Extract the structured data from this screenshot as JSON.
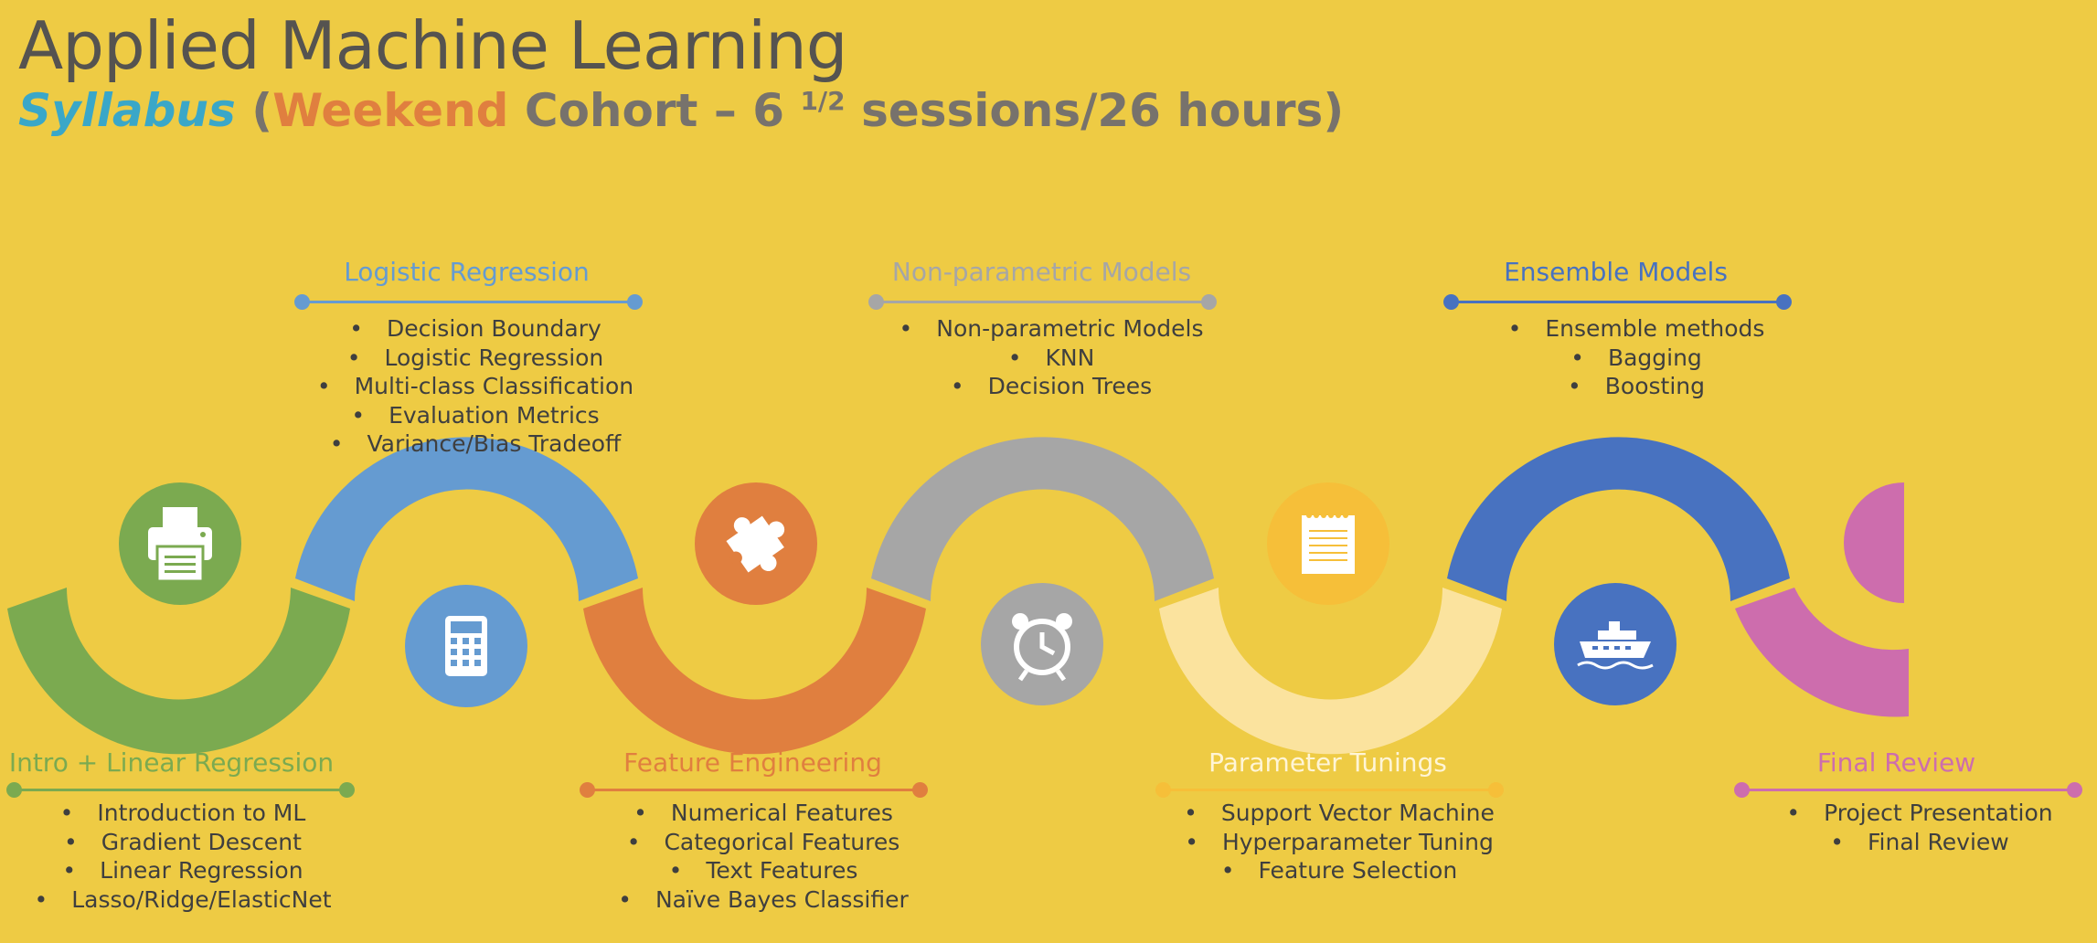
{
  "header": {
    "title": "Applied Machine Learning",
    "subtitle_syllabus": "Syllabus",
    "subtitle_open": "(",
    "subtitle_weekend": "Weekend",
    "subtitle_cohort": " Cohort – 6 ",
    "subtitle_fraction": "1/2",
    "subtitle_rest": " sessions/26 hours)"
  },
  "colors": {
    "background": "#EECB44",
    "green": "#7BAA50",
    "light_blue": "#659BD1",
    "orange": "#E07F3F",
    "gray": "#A6A6A6",
    "light_yellow": "#FBE39E",
    "blue": "#4872C0",
    "magenta": "#CD6DAD",
    "gold_icon": "#F6BF39"
  },
  "modules": [
    {
      "title": "Intro + Linear Regression",
      "items": [
        "Introduction to ML",
        "Gradient Descent",
        "Linear Regression",
        "Lasso/Ridge/ElasticNet"
      ]
    },
    {
      "title": "Logistic Regression",
      "items": [
        "Decision Boundary",
        "Logistic Regression",
        "Multi-class Classification",
        "Evaluation Metrics",
        "Variance/Bias Tradeoff"
      ]
    },
    {
      "title": "Feature Engineering",
      "items": [
        "Numerical Features",
        "Categorical Features",
        "Text Features",
        "Naïve Bayes Classifier"
      ]
    },
    {
      "title": "Non-parametric Models",
      "items": [
        "Non-parametric Models",
        "KNN",
        "Decision Trees"
      ]
    },
    {
      "title": "Parameter Tunings",
      "items": [
        "Support Vector Machine",
        "Hyperparameter Tuning",
        "Feature Selection"
      ]
    },
    {
      "title": "Ensemble Models",
      "items": [
        "Ensemble methods",
        "Bagging",
        "Boosting"
      ]
    },
    {
      "title": "Final Review",
      "items": [
        "Project Presentation",
        "Final Review"
      ]
    }
  ],
  "icons": [
    "printer-icon",
    "calculator-icon",
    "puzzle-icon",
    "alarm-clock-icon",
    "notepad-icon",
    "ship-icon"
  ]
}
